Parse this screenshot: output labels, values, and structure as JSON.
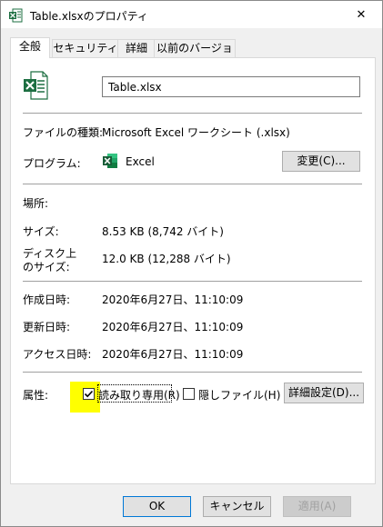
{
  "window": {
    "title": "Table.xlsxのプロパティ",
    "close_glyph": "✕"
  },
  "tabs": [
    {
      "label": "全般",
      "active": true
    },
    {
      "label": "セキュリティ",
      "active": false
    },
    {
      "label": "詳細",
      "active": false
    },
    {
      "label": "以前のバージョン",
      "active": false
    }
  ],
  "general": {
    "filename": "Table.xlsx",
    "file_type_label": "ファイルの種類:",
    "file_type_value": "Microsoft Excel ワークシート (.xlsx)",
    "program_label": "プログラム:",
    "program_value": "Excel",
    "change_button": "変更(C)...",
    "location_label": "場所:",
    "location_value": "",
    "size_label": "サイズ:",
    "size_value": "8.53 KB (8,742 バイト)",
    "size_on_disk_label_line1": "ディスク上",
    "size_on_disk_label_line2": "のサイズ:",
    "size_on_disk_value": "12.0 KB (12,288 バイト)",
    "created_label": "作成日時:",
    "created_value": "2020年6月27日、11:10:09",
    "modified_label": "更新日時:",
    "modified_value": "2020年6月27日、11:10:09",
    "accessed_label": "アクセス日時:",
    "accessed_value": "2020年6月27日、11:10:09",
    "attributes_label": "属性:",
    "readonly_label": "読み取り専用(R)",
    "readonly_checked": true,
    "hidden_label": "隠しファイル(H)",
    "hidden_checked": false,
    "advanced_button": "詳細設定(D)..."
  },
  "footer": {
    "ok": "OK",
    "cancel": "キャンセル",
    "apply": "適用(A)"
  },
  "colors": {
    "excel_green": "#1d6f42",
    "highlight": "#ffff00",
    "accent": "#0078d7"
  },
  "icons": [
    "excel-file-icon",
    "close-icon",
    "excel-app-icon",
    "checkbox-checked-icon",
    "checkbox-unchecked-icon"
  ]
}
